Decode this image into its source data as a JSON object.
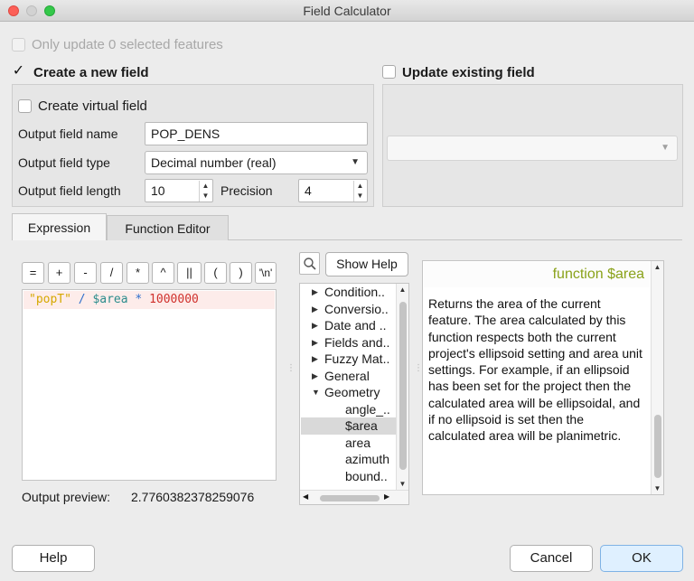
{
  "window": {
    "title": "Field Calculator"
  },
  "only_update": {
    "label": "Only update 0 selected features",
    "checked": false,
    "enabled": false
  },
  "create_new": {
    "label": "Create a new field",
    "checked": true,
    "check_mark": "✓",
    "virtual_label": "Create virtual field",
    "name_label": "Output field name",
    "name_value": "POP_DENS",
    "type_label": "Output field type",
    "type_value": "Decimal number (real)",
    "length_label": "Output field length",
    "length_value": "10",
    "precision_label": "Precision",
    "precision_value": "4"
  },
  "update_existing": {
    "label": "Update existing field",
    "checked": false,
    "combo_value": ""
  },
  "tabs": [
    {
      "label": "Expression",
      "active": true
    },
    {
      "label": "Function Editor",
      "active": false
    }
  ],
  "operators": [
    "=",
    "+",
    "-",
    "/",
    "*",
    "^",
    "||",
    "(",
    ")",
    "'\\n'"
  ],
  "expression": {
    "tokens": [
      {
        "text": "\"popT\"",
        "kind": "str"
      },
      {
        "text": " / ",
        "kind": "op"
      },
      {
        "text": "$area",
        "kind": "var"
      },
      {
        "text": " * ",
        "kind": "op"
      },
      {
        "text": "1000000",
        "kind": "num"
      }
    ]
  },
  "preview": {
    "label": "Output preview:",
    "value": "2.7760382378259076"
  },
  "search": {
    "icon": "search-icon",
    "placeholder": ""
  },
  "show_help_label": "Show Help",
  "function_tree": [
    {
      "label": "Condition..",
      "level": 0,
      "expanded": false
    },
    {
      "label": "Conversio..",
      "level": 0,
      "expanded": false
    },
    {
      "label": "Date and ..",
      "level": 0,
      "expanded": false
    },
    {
      "label": "Fields and..",
      "level": 0,
      "expanded": false
    },
    {
      "label": "Fuzzy Mat..",
      "level": 0,
      "expanded": false
    },
    {
      "label": "General",
      "level": 0,
      "expanded": false
    },
    {
      "label": "Geometry",
      "level": 0,
      "expanded": true
    },
    {
      "label": "angle_..",
      "level": 1
    },
    {
      "label": "$area",
      "level": 1,
      "selected": true
    },
    {
      "label": "area",
      "level": 1
    },
    {
      "label": "azimuth",
      "level": 1
    },
    {
      "label": "bound..",
      "level": 1
    }
  ],
  "help": {
    "title": "function $area",
    "body": "Returns the area of the current feature. The area calculated by this function respects both the current project's ellipsoid setting and area unit settings. For example, if an ellipsoid has been set for the project then the calculated area will be ellipsoidal, and if no ellipsoid is set then the calculated area will be planimetric."
  },
  "buttons": {
    "help": "Help",
    "cancel": "Cancel",
    "ok": "OK"
  },
  "colors": {
    "accent_green": "#8aa21a",
    "ok_bg": "#dff0ff",
    "close": "#fc5f57",
    "maximize": "#34c84a"
  }
}
